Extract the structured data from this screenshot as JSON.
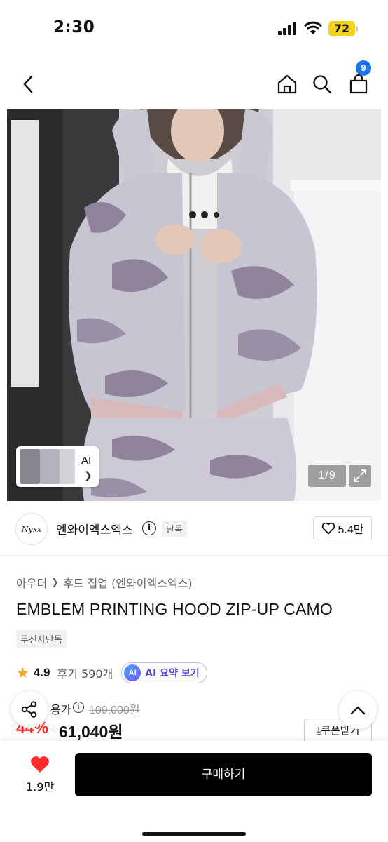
{
  "status_bar": {
    "time": "2:30",
    "battery": "72"
  },
  "header": {
    "cart_count": "9"
  },
  "gallery": {
    "thumb_label": "AI",
    "page_indicator": "1/9"
  },
  "brand": {
    "logo_text": "Nyxx",
    "name": "엔와이엑스엑스",
    "exclusive_badge": "단독",
    "likes": "5.4만"
  },
  "product": {
    "breadcrumb": [
      "아우터",
      "후드 집업 (엔와이엑스엑스)"
    ],
    "title": "EMBLEM PRINTING HOOD ZIP-UP CAMO",
    "musinsa_badge": "무신사단독",
    "rating": "4.9",
    "review_link": "후기 590개",
    "ai_badge": "AI",
    "ai_summary_label": "AI 요약 보기"
  },
  "price": {
    "orig_label": "용가",
    "orig_price": "109,000원",
    "discount": "44%",
    "sale_price": "61,040원",
    "coupon_label": "쿠폰받기"
  },
  "bottom_bar": {
    "heart_count": "1.9만",
    "buy_label": "구매하기"
  },
  "colors": {
    "accent_red": "#ff2a2a",
    "badge_blue": "#1a73e8",
    "battery_yellow": "#f5d21a",
    "ai_purple": "#5a3fd6"
  }
}
